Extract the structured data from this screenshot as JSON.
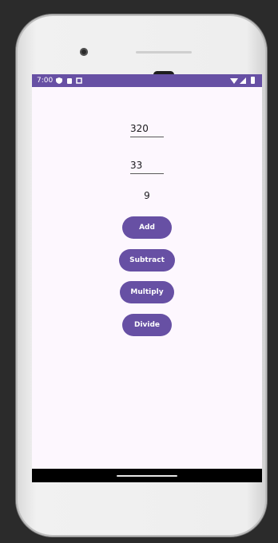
{
  "status_bar": {
    "time": "7:00",
    "icons_left": [
      "shield-icon",
      "sim-icon",
      "notification-icon"
    ],
    "icons_right": [
      "wifi-icon",
      "signal-icon",
      "battery-icon"
    ],
    "color": "#6750a4"
  },
  "form": {
    "first_number": "320",
    "second_number": "33",
    "result": "9"
  },
  "buttons": {
    "add": "Add",
    "subtract": "Subtract",
    "multiply": "Multiply",
    "divide": "Divide",
    "color": "#6750a4"
  },
  "screen_background": "#fdf7fe"
}
